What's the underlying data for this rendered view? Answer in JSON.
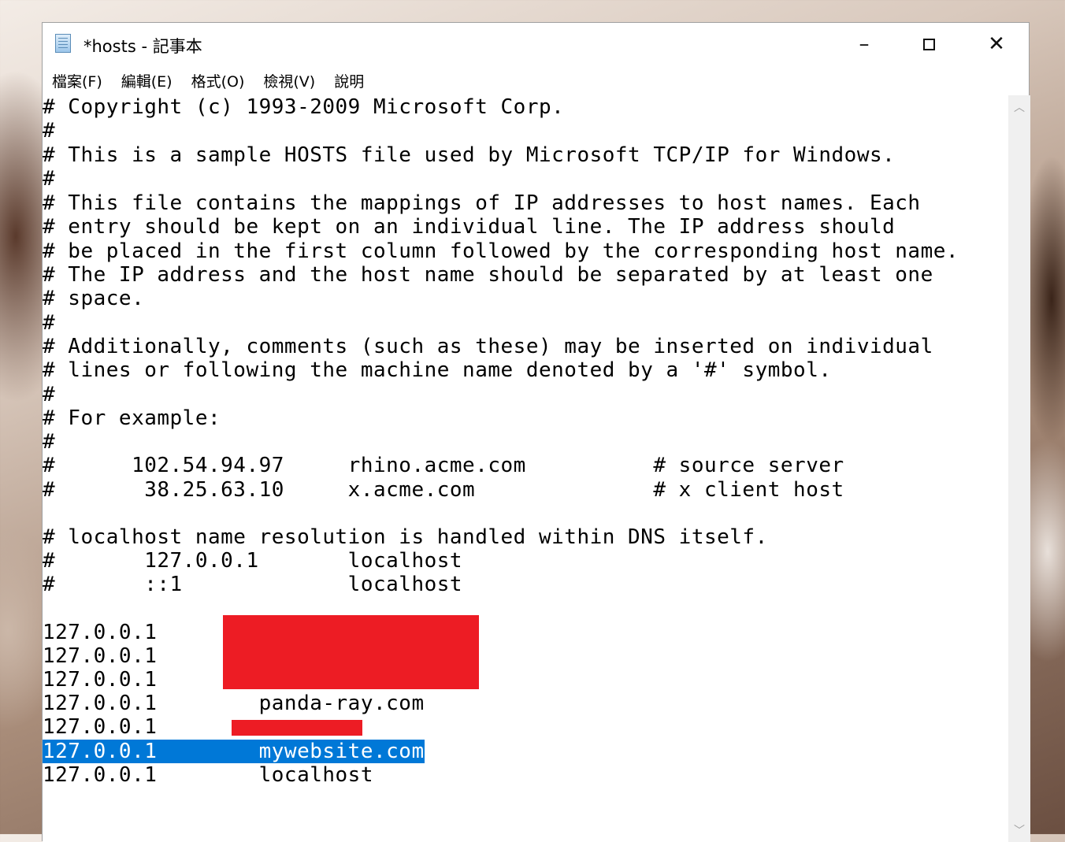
{
  "window": {
    "title": "*hosts - 記事本",
    "minimize_label": "–",
    "close_label": "✕"
  },
  "menu": [
    {
      "label": "檔案(F)"
    },
    {
      "label": "編輯(E)"
    },
    {
      "label": "格式(O)"
    },
    {
      "label": "檢視(V)"
    },
    {
      "label": "說明"
    }
  ],
  "editor": {
    "lines": [
      "# Copyright (c) 1993-2009 Microsoft Corp.",
      "#",
      "# This is a sample HOSTS file used by Microsoft TCP/IP for Windows.",
      "#",
      "# This file contains the mappings of IP addresses to host names. Each",
      "# entry should be kept on an individual line. The IP address should",
      "# be placed in the first column followed by the corresponding host name.",
      "# The IP address and the host name should be separated by at least one",
      "# space.",
      "#",
      "# Additionally, comments (such as these) may be inserted on individual",
      "# lines or following the machine name denoted by a '#' symbol.",
      "#",
      "# For example:",
      "#",
      "#      102.54.94.97     rhino.acme.com          # source server",
      "#       38.25.63.10     x.acme.com              # x client host",
      "",
      "# localhost name resolution is handled within DNS itself.",
      "#       127.0.0.1       localhost",
      "#       ::1             localhost",
      "",
      "127.0.0.1",
      "127.0.0.1",
      "127.0.0.1",
      "127.0.0.1        panda-ray.com",
      "127.0.0.1",
      "127.0.0.1        mywebsite.com",
      "127.0.0.1        localhost"
    ],
    "selected_line_index": 27
  },
  "scrollbar": {
    "up_icon": "chevron-up-icon",
    "down_icon": "chevron-down-icon"
  }
}
